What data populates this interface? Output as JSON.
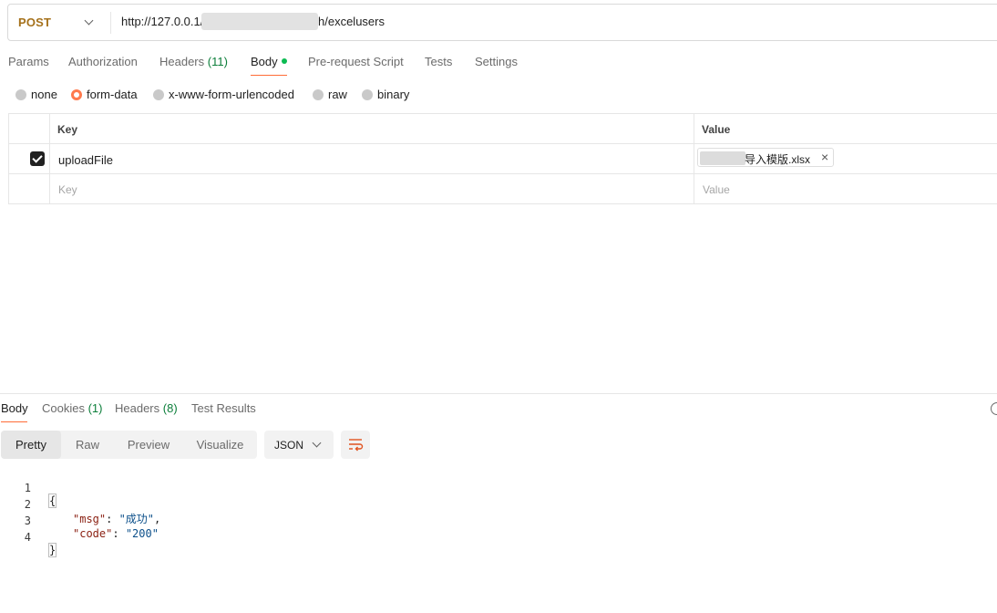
{
  "request": {
    "method": "POST",
    "url_prefix": "http://127.0.0.1/",
    "url_suffix": "h/excelusers"
  },
  "request_tabs": [
    {
      "label": "Params"
    },
    {
      "label": "Authorization"
    },
    {
      "label": "Headers",
      "count": "(11)"
    },
    {
      "label": "Body"
    },
    {
      "label": "Pre-request Script"
    },
    {
      "label": "Tests"
    },
    {
      "label": "Settings"
    }
  ],
  "body_modes": [
    "none",
    "form-data",
    "x-www-form-urlencoded",
    "raw",
    "binary"
  ],
  "form_table": {
    "headers": {
      "key": "Key",
      "value": "Value"
    },
    "rows": [
      {
        "key": "uploadFile",
        "file_name": "导入模版.xlsx",
        "file_remove": "×"
      }
    ],
    "placeholder": {
      "key": "Key",
      "value": "Value"
    }
  },
  "response_tabs": [
    {
      "label": "Body"
    },
    {
      "label": "Cookies",
      "count": "(1)"
    },
    {
      "label": "Headers",
      "count": "(8)"
    },
    {
      "label": "Test Results"
    }
  ],
  "view_modes": [
    "Pretty",
    "Raw",
    "Preview",
    "Visualize"
  ],
  "format": "JSON",
  "code": {
    "line_numbers": [
      "1",
      "2",
      "3",
      "4"
    ],
    "open": "{",
    "close": "}",
    "k1": "\"msg\"",
    "v1": "\"成功\"",
    "k2": "\"code\"",
    "v2": "\"200\"",
    "colon": ": ",
    "comma": ","
  }
}
